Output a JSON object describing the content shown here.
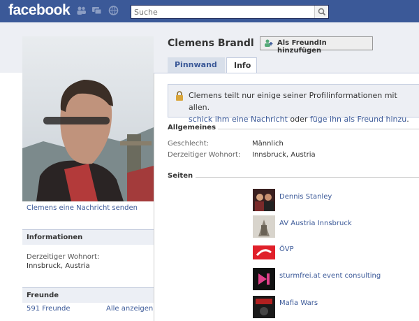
{
  "topbar": {
    "logo": "facebook",
    "search_placeholder": "Suche",
    "icons": [
      "friends-icon",
      "messages-icon",
      "notifications-icon",
      "search-icon"
    ],
    "color": "#3b5998"
  },
  "profile": {
    "name": "Clemens Brandl",
    "add_friend_label": "Als FreundIn hinzufügen",
    "send_message_label": "Clemens eine Nachricht senden"
  },
  "tabs": [
    {
      "label": "Pinnwand",
      "active": false
    },
    {
      "label": "Info",
      "active": true
    }
  ],
  "notice": {
    "line1": "Clemens teilt nur einige seiner Profilinformationen mit allen. ",
    "link1": "schick ihm eine Nachricht",
    "mid": " oder ",
    "link2": "füge ihn als Freund hinzu",
    "end": "."
  },
  "allgemeines": {
    "title": "Allgemeines",
    "rows": [
      {
        "label": "Geschlecht:",
        "value": "Männlich"
      },
      {
        "label": "Derzeitiger Wohnort:",
        "value": "Innsbruck, Austria"
      }
    ]
  },
  "seiten": {
    "title": "Seiten",
    "items": [
      {
        "name": "Dennis Stanley"
      },
      {
        "name": "AV Austria Innsbruck"
      },
      {
        "name": "ÖVP"
      },
      {
        "name": "sturmfrei.at event consulting"
      },
      {
        "name": "Mafia Wars"
      }
    ]
  },
  "sidebar": {
    "info_title": "Informationen",
    "wohnort_label": "Derzeitiger Wohnort:",
    "wohnort_value": "Innsbruck, Austria",
    "friends_title": "Freunde",
    "friends_count": "591 Freunde",
    "show_all": "Alle anzeigen"
  }
}
